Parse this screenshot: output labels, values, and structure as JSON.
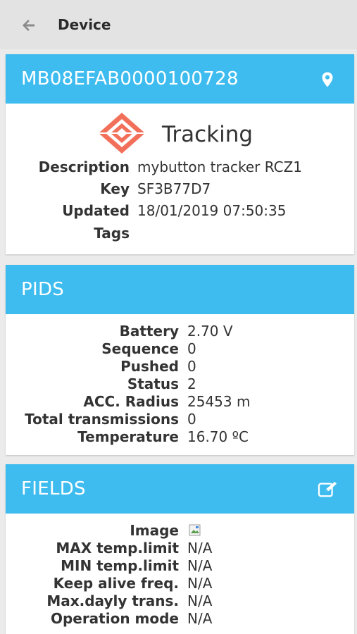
{
  "header": {
    "title": "Device",
    "back_icon": "arrow-left-icon"
  },
  "device": {
    "id": "MB08EFAB0000100728",
    "location_icon": "map-pin-icon",
    "status": "Tracking",
    "status_icon": "tracking-logo-icon",
    "details": [
      {
        "key": "Description",
        "value": "mybutton tracker RCZ1"
      },
      {
        "key": "Key",
        "value": "SF3B77D7"
      },
      {
        "key": "Updated",
        "value": "18/01/2019 07:50:35"
      },
      {
        "key": "Tags",
        "value": ""
      }
    ]
  },
  "pids": {
    "title": "PIDS",
    "rows": [
      {
        "key": "Battery",
        "value": "2.70 V"
      },
      {
        "key": "Sequence",
        "value": "0"
      },
      {
        "key": "Pushed",
        "value": "0"
      },
      {
        "key": "Status",
        "value": "2"
      },
      {
        "key": "ACC. Radius",
        "value": "25453 m"
      },
      {
        "key": "Total transmissions",
        "value": "0"
      },
      {
        "key": "Temperature",
        "value": "16.70 ºC"
      }
    ]
  },
  "fields": {
    "title": "FIELDS",
    "edit_icon": "edit-icon",
    "rows": [
      {
        "key": "Image",
        "value": ""
      },
      {
        "key": "MAX temp.limit",
        "value": "N/A"
      },
      {
        "key": "MIN temp.limit",
        "value": "N/A"
      },
      {
        "key": "Keep alive freq.",
        "value": "N/A"
      },
      {
        "key": "Max.dayly trans.",
        "value": "N/A"
      },
      {
        "key": "Operation mode",
        "value": "N/A"
      }
    ]
  },
  "colors": {
    "accent": "#3ebcef",
    "logo": "#f2705a",
    "topbar": "#e3e3e3",
    "background": "#ebebeb"
  }
}
